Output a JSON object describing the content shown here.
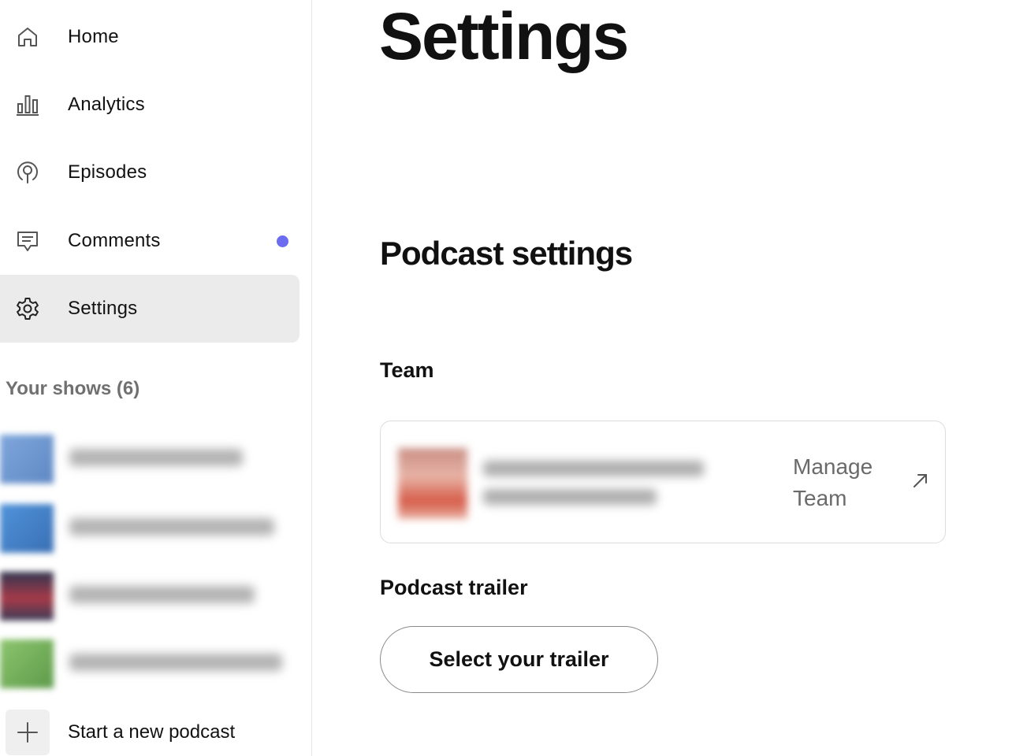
{
  "sidebar": {
    "nav": [
      {
        "label": "Home",
        "icon": "home-icon"
      },
      {
        "label": "Analytics",
        "icon": "bar-chart-icon"
      },
      {
        "label": "Episodes",
        "icon": "podcast-icon"
      },
      {
        "label": "Comments",
        "icon": "comment-icon",
        "has_notification": true
      },
      {
        "label": "Settings",
        "icon": "gear-icon",
        "active": true
      }
    ],
    "shows_title": "Your shows (6)",
    "new_podcast_label": "Start a new podcast"
  },
  "main": {
    "title": "Settings",
    "section_title": "Podcast settings",
    "team": {
      "title": "Team",
      "manage_label": "Manage Team"
    },
    "trailer": {
      "title": "Podcast trailer",
      "button_label": "Select your trailer"
    }
  },
  "colors": {
    "notification_dot": "#6b6cf0",
    "active_nav_bg": "#ebebeb",
    "muted_text": "#707070"
  }
}
